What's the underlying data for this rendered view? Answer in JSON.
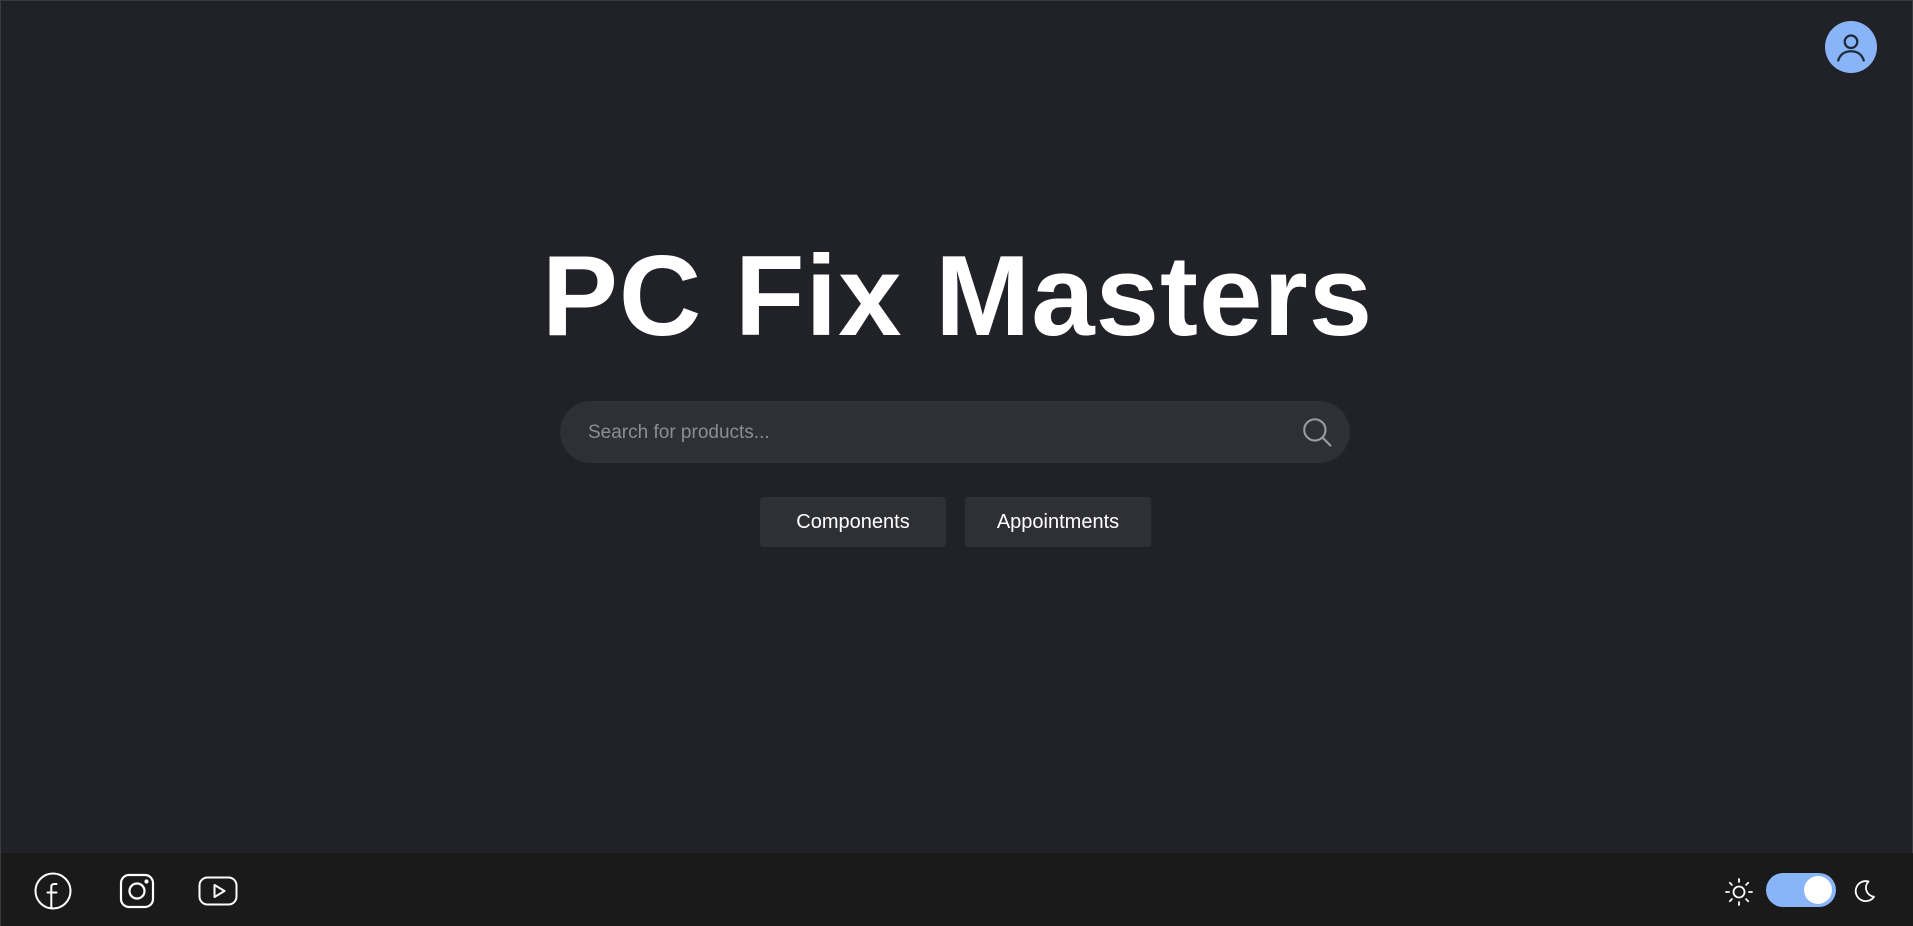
{
  "header": {
    "avatar_icon": "user-icon",
    "avatar_color": "#8ab4f8"
  },
  "hero": {
    "title": "PC Fix Masters"
  },
  "search": {
    "placeholder": "Search for products...",
    "value": "",
    "icon": "search-icon"
  },
  "nav": {
    "components_label": "Components",
    "appointments_label": "Appointments"
  },
  "footer": {
    "social": [
      {
        "icon": "facebook-icon"
      },
      {
        "icon": "instagram-icon"
      },
      {
        "icon": "youtube-icon"
      }
    ],
    "theme_toggle": {
      "light_icon": "sun-icon",
      "dark_icon": "moon-icon",
      "state": "dark",
      "accent": "#8ab4f8"
    }
  },
  "colors": {
    "background": "#212227",
    "footer_background": "#1a1a1b",
    "surface": "#2f3035",
    "accent": "#8ab4f8"
  }
}
